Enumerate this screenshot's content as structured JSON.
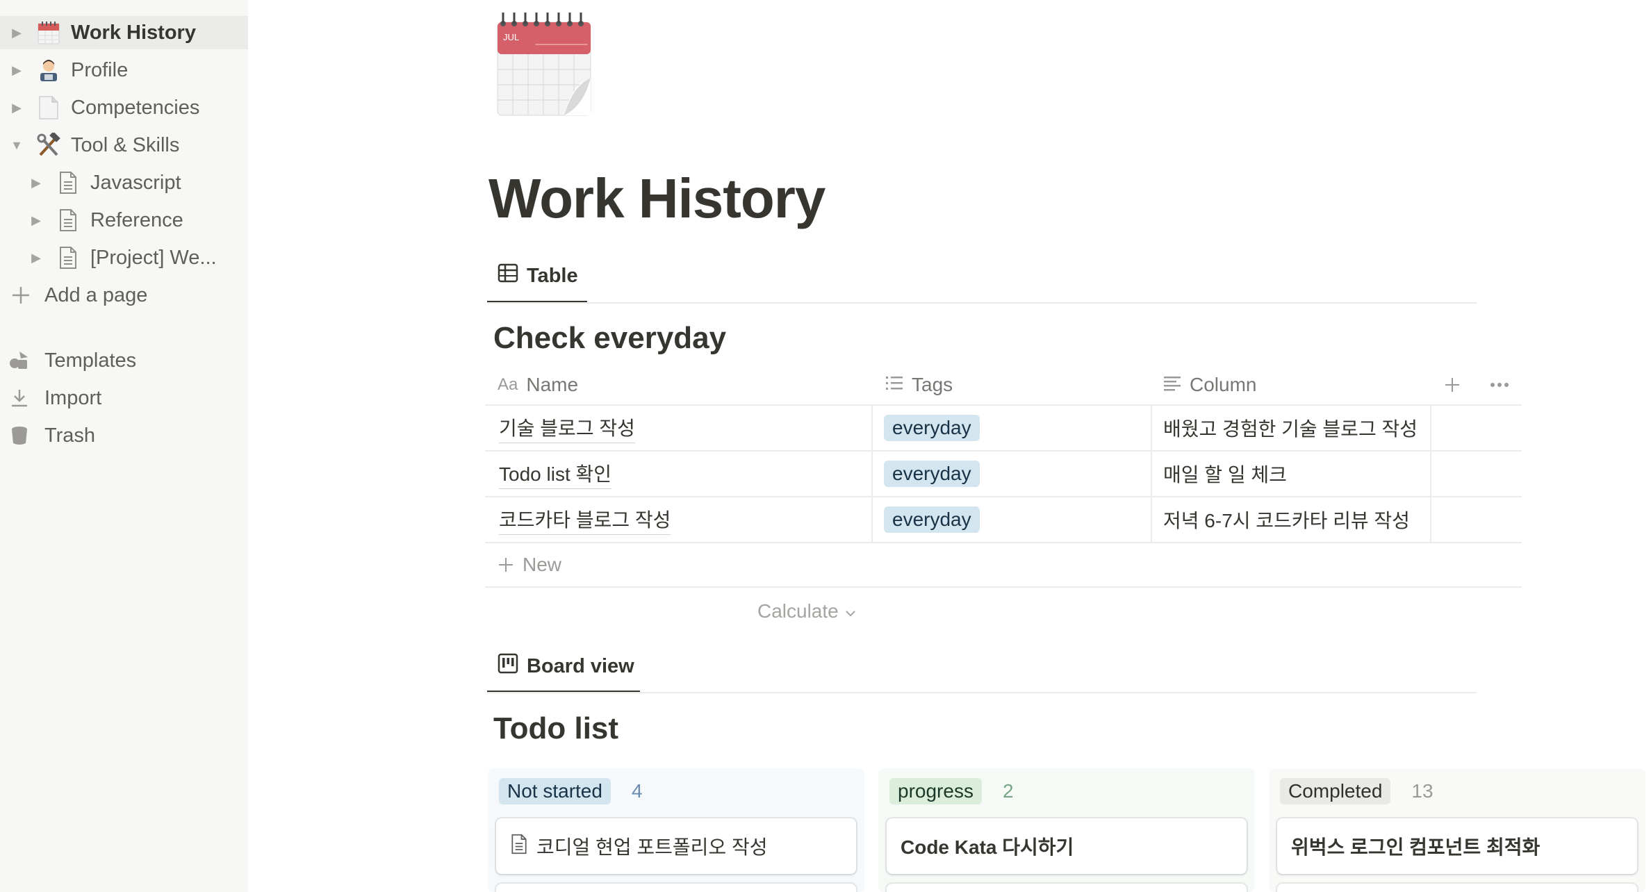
{
  "sidebar": {
    "items": [
      {
        "label": "Work History",
        "icon": "calendar-icon",
        "expanded": false
      },
      {
        "label": "Profile",
        "icon": "technologist-icon",
        "expanded": false
      },
      {
        "label": "Competencies",
        "icon": "page-icon",
        "expanded": false
      },
      {
        "label": "Tool & Skills",
        "icon": "hammer-wrench-icon",
        "expanded": true
      },
      {
        "label": "Javascript",
        "icon": "document-icon",
        "expanded": false
      },
      {
        "label": "Reference",
        "icon": "document-icon",
        "expanded": false
      },
      {
        "label": "[Project] We...",
        "icon": "document-icon",
        "expanded": false
      }
    ],
    "add_page": "Add a page",
    "templates": "Templates",
    "import": "Import",
    "trash": "Trash"
  },
  "page": {
    "title": "Work History",
    "cover_icon": "calendar-icon",
    "cover_icon_month": "JUL"
  },
  "table_view": {
    "tab_label": "Table",
    "title": "Check everyday",
    "columns": [
      "Name",
      "Tags",
      "Column"
    ],
    "rows": [
      {
        "name": "기술 블로그 작성",
        "tag": "everyday",
        "column": "배웠고 경험한 기술 블로그 작성"
      },
      {
        "name": "Todo list 확인",
        "tag": "everyday",
        "column": "매일 할 일 체크"
      },
      {
        "name": "코드카타 블로그 작성",
        "tag": "everyday",
        "column": "저녁 6-7시 코드카타 리뷰 작성"
      }
    ],
    "new_label": "New",
    "calculate_label": "Calculate"
  },
  "board_view": {
    "tab_label": "Board view",
    "title": "Todo list",
    "groups": [
      {
        "label": "Not started",
        "count": "4",
        "first_card": "코디얼 현업 포트폴리오 작성",
        "bg": "#f5f9fc",
        "pill_bg": "#d3e5ef",
        "count_color": "#6a8cae"
      },
      {
        "label": "progress",
        "count": "2",
        "first_card": "Code Kata 다시하기",
        "bg": "#f6faf7",
        "pill_bg": "#dbeddb",
        "count_color": "#79a488"
      },
      {
        "label": "Completed",
        "count": "13",
        "first_card": "위벅스 로그인 컴포넌트 최적화",
        "bg": "#f9f9f8",
        "pill_bg": "#e9e9e7",
        "count_color": "#9b9a97"
      }
    ]
  },
  "colors": {
    "sidebar_bg": "#f7f7f5",
    "text": "#37352f",
    "tag_blue": "#d3e5ef"
  }
}
